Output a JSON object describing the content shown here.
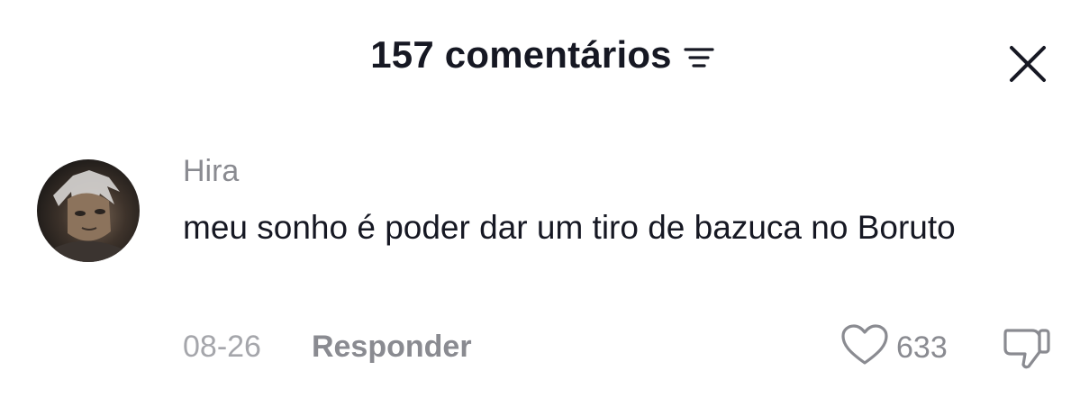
{
  "header": {
    "title": "157 comentários",
    "filter_icon": "sort-filter-icon",
    "close_icon": "close-icon"
  },
  "comment": {
    "avatar": "user-avatar",
    "username": "Hira",
    "text": "meu sonho é poder dar um tiro de bazuca no Boruto",
    "date": "08-26",
    "reply_label": "Responder",
    "like_icon": "heart-icon",
    "like_count": "633",
    "dislike_icon": "thumbs-down-icon"
  },
  "colors": {
    "primary_text": "#161823",
    "secondary_text": "#8a8b91",
    "muted_text": "#a5a6ab",
    "background": "#ffffff"
  }
}
